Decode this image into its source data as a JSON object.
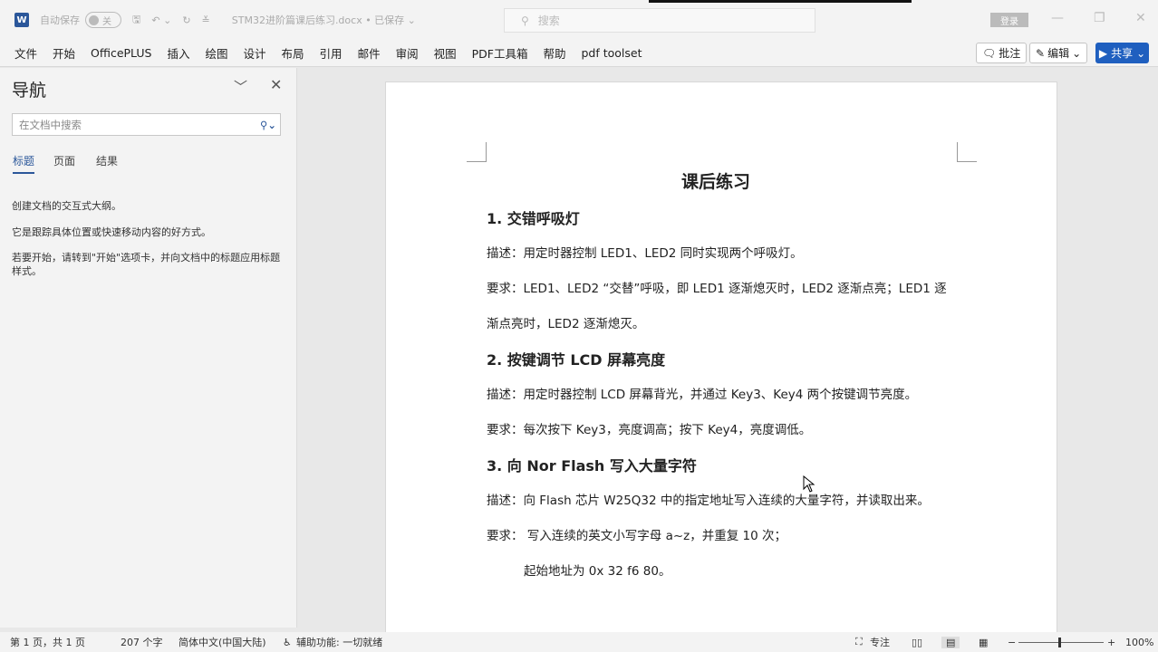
{
  "titlebar": {
    "app_icon": "W",
    "autosave_label": "自动保存",
    "autosave_state": "关",
    "doc_title": "STM32进阶篇课后练习.docx • 已保存 ⌄",
    "search_placeholder": "搜索",
    "login_label": "登录"
  },
  "ribbon": {
    "tabs": [
      "文件",
      "开始",
      "OfficePLUS",
      "插入",
      "绘图",
      "设计",
      "布局",
      "引用",
      "邮件",
      "审阅",
      "视图",
      "PDF工具箱",
      "帮助",
      "pdf toolset"
    ],
    "comment_label": "批注",
    "edit_label": "编辑",
    "share_label": "共享"
  },
  "nav": {
    "title": "导航",
    "search_placeholder": "在文档中搜索",
    "tabs": [
      "标题",
      "页面",
      "结果"
    ],
    "active_tab": "标题",
    "hints": [
      "创建文档的交互式大纲。",
      "它是跟踪具体位置或快速移动内容的好方式。",
      "若要开始，请转到\"开始\"选项卡，并向文档中的标题应用标题样式。"
    ]
  },
  "document": {
    "title": "课后练习",
    "lines": [
      "1.  交错呼吸灯",
      "描述：用定时器控制 LED1、LED2 同时实现两个呼吸灯。",
      "要求：LED1、LED2 “交替”呼吸，即 LED1 逐渐熄灭时，LED2 逐渐点亮；LED1 逐",
      "渐点亮时，LED2 逐渐熄灭。",
      "2.  按键调节 LCD 屏幕亮度",
      "描述：用定时器控制 LCD 屏幕背光，并通过 Key3、Key4 两个按键调节亮度。",
      "要求：每次按下  Key3，亮度调高；按下 Key4，亮度调低。",
      "3.  向  Nor Flash  写入大量字符",
      "描述：向  Flash  芯片 W25Q32  中的指定地址写入连续的大量字符，并读取出来。",
      "要求：  写入连续的英文小写字母 a~z，并重复  10  次；",
      "起始地址为  0x 32 f6 80。"
    ]
  },
  "status": {
    "page": "第 1 页，共 1 页",
    "words": "207 个字",
    "language": "简体中文(中国大陆)",
    "accessibility": "辅助功能: 一切就绪",
    "focus": "专注",
    "zoom_minus": "−",
    "zoom_plus": "+",
    "zoom": "100%",
    "zoom_percent": 100
  },
  "colors": {
    "accent": "#2b579a",
    "share": "#1f5fbf"
  }
}
